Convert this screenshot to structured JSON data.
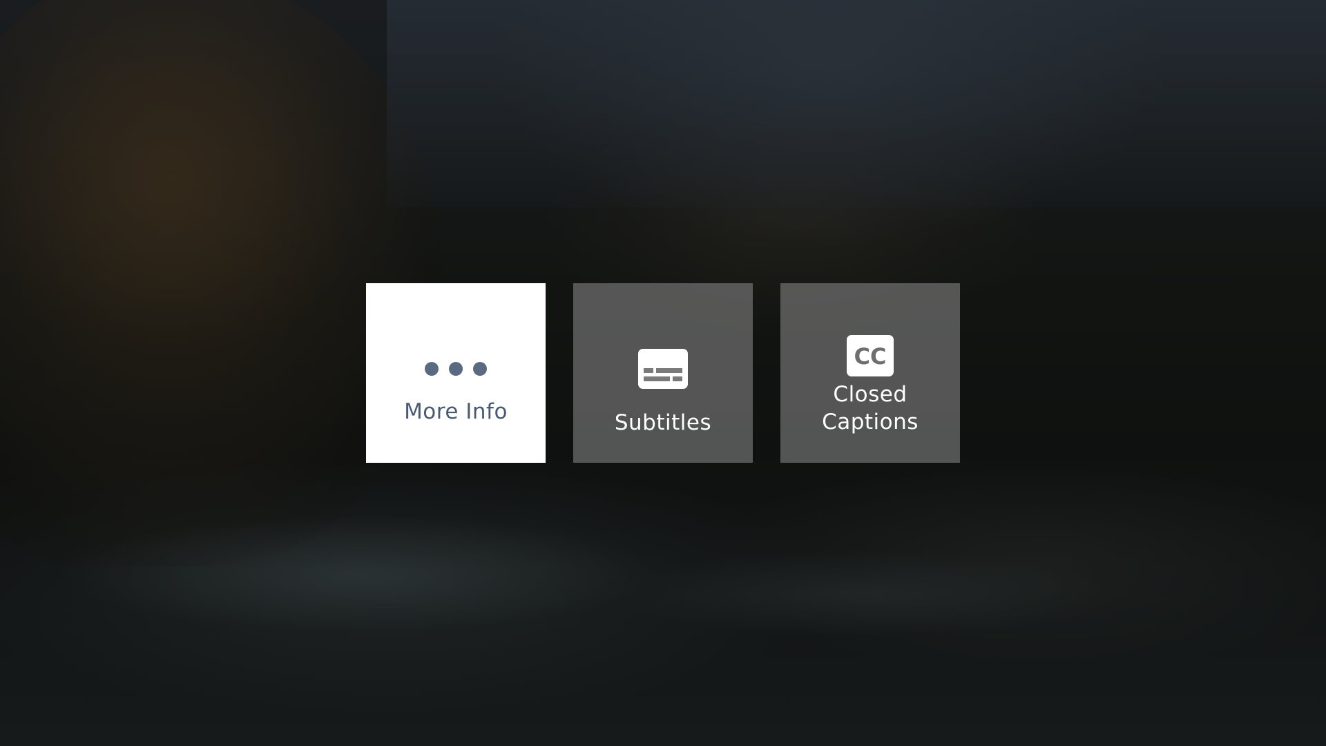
{
  "menu": {
    "items": [
      {
        "label": "More Info",
        "icon": "more-dots-icon",
        "focused": true
      },
      {
        "label": "Subtitles",
        "icon": "subtitles-icon",
        "focused": false
      },
      {
        "label_lines": [
          "Closed",
          "Captions"
        ],
        "icon": "closed-captions-icon",
        "focused": false,
        "icon_text": "CC"
      }
    ]
  },
  "colors": {
    "focused_background": "#ffffff",
    "focused_text": "#4a5a70",
    "unfocused_background": "#8c8c8c",
    "unfocused_text": "#ffffff"
  }
}
